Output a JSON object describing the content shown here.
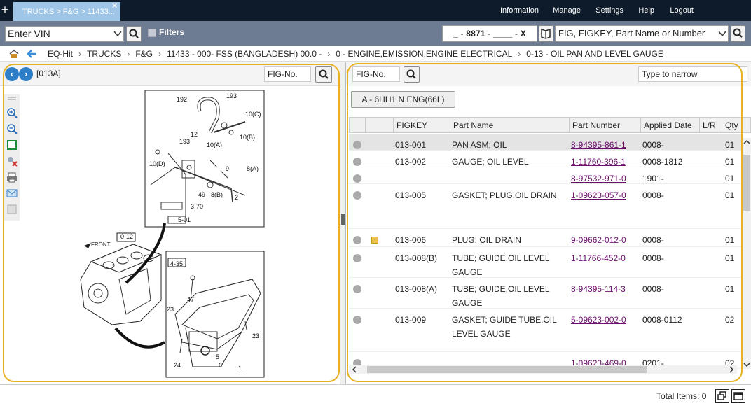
{
  "tab": {
    "label": "TRUCKS > F&G > 11433..."
  },
  "nav": [
    "Information",
    "Manage",
    "Settings",
    "Help",
    "Logout"
  ],
  "search": {
    "vin_placeholder": "Enter VIN",
    "filters_label": "Filters",
    "vin_code": "_ - 8871 - ____ - X",
    "part_placeholder": "FIG, FIGKEY, Part Name or Number"
  },
  "breadcrumb": [
    "EQ-Hit",
    "TRUCKS",
    "F&G",
    "11433 - 000- FSS (BANGLADESH) 00.0 -",
    "0 - ENGINE,EMISSION,ENGINE ELECTRICAL",
    "0-13 - OIL PAN AND LEVEL GAUGE"
  ],
  "left": {
    "fig_id": "[013A]",
    "figno_placeholder": "FIG-No."
  },
  "right": {
    "figno_placeholder": "FIG-No.",
    "narrow_placeholder": "Type to narrow",
    "engine_button": "A - 6HH1 N ENG(66L)",
    "columns": [
      "FIGKEY",
      "Part Name",
      "Part Number",
      "Applied Date",
      "L/R",
      "Qty"
    ],
    "rows": [
      {
        "figkey": "013-001",
        "name": "PAN ASM; OIL",
        "number": "8-94395-861-1",
        "date": "0008-",
        "lr": "",
        "qty": "01"
      },
      {
        "figkey": "013-002",
        "name": "GAUGE; OIL LEVEL",
        "number": "1-11760-396-1",
        "date": "0008-1812",
        "lr": "",
        "qty": "01"
      },
      {
        "figkey": "",
        "name": "",
        "number": "8-97532-971-0",
        "date": "1901-",
        "lr": "",
        "qty": "01"
      },
      {
        "figkey": "013-005",
        "name": "GASKET; PLUG,OIL DRAIN",
        "number": "1-09623-057-0",
        "date": "0008-",
        "lr": "",
        "qty": "01"
      },
      {
        "figkey": "013-006",
        "name": "PLUG; OIL DRAIN",
        "number": "9-09662-012-0",
        "date": "0008-",
        "lr": "",
        "qty": "01"
      },
      {
        "figkey": "013-008(B)",
        "name": "TUBE; GUIDE,OIL LEVEL GAUGE",
        "number": "1-11766-452-0",
        "date": "0008-",
        "lr": "",
        "qty": "01"
      },
      {
        "figkey": "013-008(A)",
        "name": "TUBE; GUIDE,OIL LEVEL GAUGE",
        "number": "8-94395-114-3",
        "date": "0008-",
        "lr": "",
        "qty": "01"
      },
      {
        "figkey": "013-009",
        "name": "GASKET; GUIDE TUBE,OIL LEVEL GAUGE",
        "number": "5-09623-002-0",
        "date": "0008-0112",
        "lr": "",
        "qty": "02"
      },
      {
        "figkey": "",
        "name": "",
        "number": "1-09623-469-0",
        "date": "0201-",
        "lr": "",
        "qty": "02"
      }
    ]
  },
  "status": {
    "total": "Total Items: 0"
  },
  "drawing_labels": [
    "192",
    "193",
    "10(C)",
    "12",
    "10(B)",
    "10(A)",
    "193",
    "10(D)",
    "9",
    "8(A)",
    "49",
    "8(B)",
    "2",
    "3-70",
    "5-01",
    "0-12",
    "FRONT",
    "4-35",
    "47",
    "23",
    "23",
    "24",
    "5",
    "6",
    "1"
  ],
  "colors": {
    "topbar": "#0d1b2a",
    "tab": "#9fc6e6",
    "searchbar": "#6d7c93",
    "link": "#6b0f6b",
    "highlight": "#e8b120"
  }
}
